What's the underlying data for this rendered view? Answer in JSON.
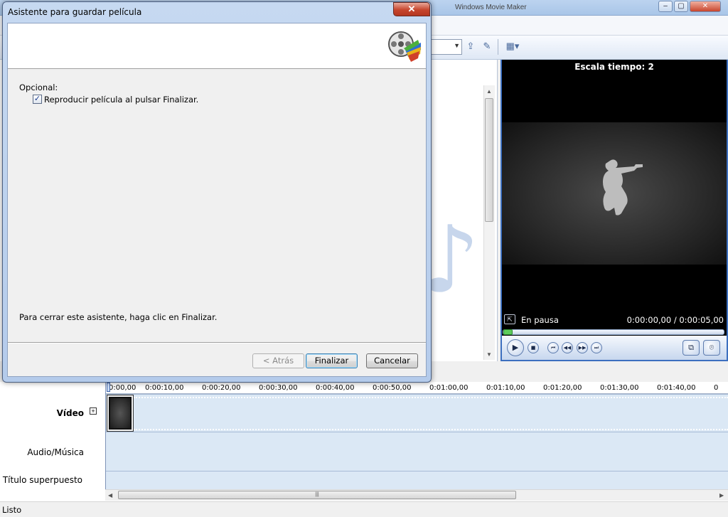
{
  "main_window": {
    "title": "Windows Movie Maker",
    "win_minimize": "–",
    "win_maximize": "▢",
    "win_close": "✕"
  },
  "dialog": {
    "title": "Asistente para guardar película",
    "close": "✕",
    "optional_label": "Opcional:",
    "play_checkbox_label": "Reproducir película al pulsar Finalizar.",
    "play_checked": true,
    "checkmark": "✓",
    "finish_hint": "Para cerrar este asistente, haga clic en Finalizar.",
    "buttons": {
      "back": "< Atrás",
      "finish": "Finalizar",
      "cancel": "Cancelar"
    }
  },
  "monitor": {
    "title": "Escala tiempo: 2",
    "status": "En pausa",
    "time": "0:00:00,00 / 0:00:05,00",
    "progress": 0
  },
  "timeline": {
    "ruler": [
      "0:00,00",
      "0:00:10,00",
      "0:00:20,00",
      "0:00:30,00",
      "0:00:40,00",
      "0:00:50,00",
      "0:01:00,00",
      "0:01:10,00",
      "0:01:20,00",
      "0:01:30,00",
      "0:01:40,00",
      "0"
    ],
    "tracks": {
      "video": "Vídeo",
      "audio": "Audio/Música",
      "title": "Título superpuesto"
    },
    "expand": "+"
  },
  "statusbar": {
    "text": "Listo"
  },
  "icons": {
    "logo": "film-reel-icon",
    "soldier": "soldier-silhouette-icon"
  },
  "colors": {
    "monitor_border": "#3c6fbf",
    "track_bg": "#dbe8f5",
    "dialog_frame": "#b4cbeb"
  }
}
